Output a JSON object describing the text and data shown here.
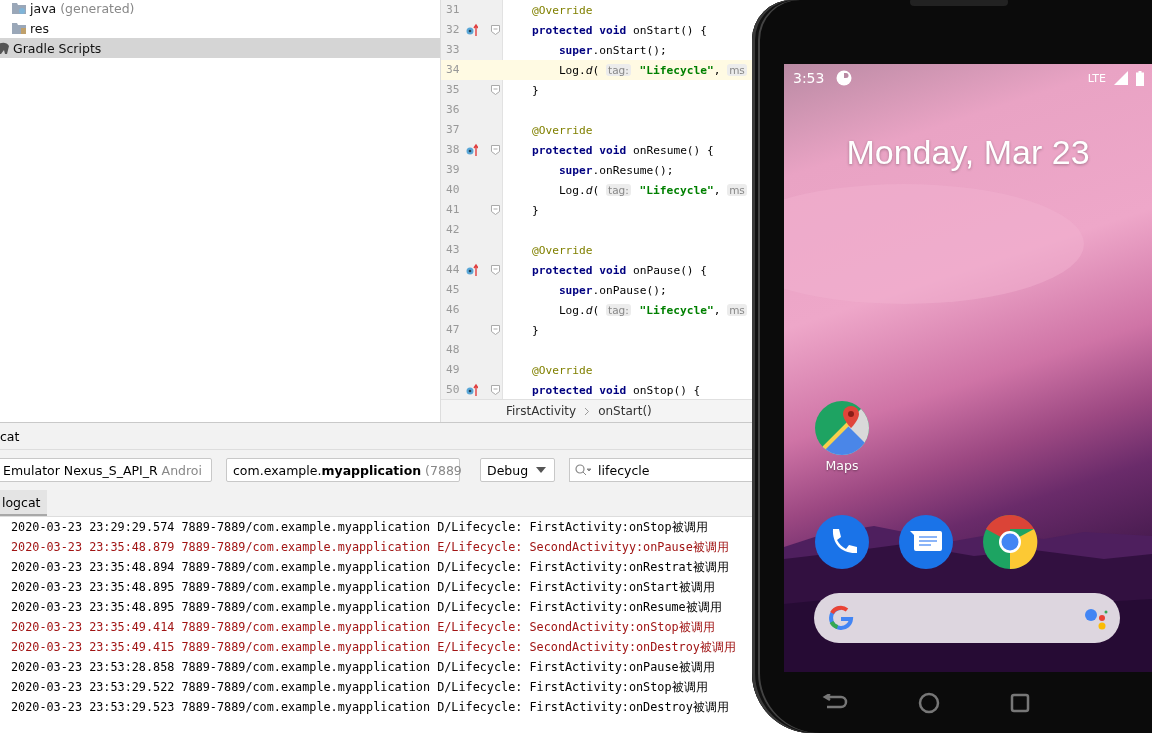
{
  "project_tree": {
    "items": [
      {
        "label": "java",
        "note": "(generated)",
        "kind": "java-folder",
        "selected": false
      },
      {
        "label": "res",
        "kind": "res-folder",
        "selected": false
      },
      {
        "label": "Gradle Scripts",
        "kind": "gradle",
        "selected": true
      }
    ]
  },
  "editor": {
    "lines": [
      {
        "number": "31",
        "override": false,
        "fold": false,
        "current": false,
        "segments": [
          {
            "t": "    @Override",
            "kind": "annotation"
          }
        ]
      },
      {
        "number": "32",
        "override": true,
        "fold": true,
        "current": false,
        "segments": [
          {
            "t": "    protected void",
            "kind": "keyword"
          },
          {
            "t": " onStart() {",
            "kind": "plain"
          }
        ]
      },
      {
        "number": "33",
        "override": false,
        "fold": false,
        "current": false,
        "segments": [
          {
            "t": "        super",
            "kind": "keyword"
          },
          {
            "t": ".onStart();",
            "kind": "plain"
          }
        ]
      },
      {
        "number": "34",
        "override": false,
        "fold": false,
        "current": true,
        "segments": [
          {
            "t": "        Log.",
            "kind": "plain"
          },
          {
            "t": "d",
            "kind": "italic"
          },
          {
            "t": "( ",
            "kind": "plain"
          },
          {
            "t": "tag:",
            "kind": "hint"
          },
          {
            "t": " \"Lifecycle\"",
            "kind": "string"
          },
          {
            "t": ", ",
            "kind": "plain"
          },
          {
            "t": "ms",
            "kind": "hint"
          }
        ]
      },
      {
        "number": "35",
        "override": false,
        "fold": true,
        "current": false,
        "segments": [
          {
            "t": "    }",
            "kind": "plain"
          }
        ]
      },
      {
        "number": "36",
        "override": false,
        "fold": false,
        "current": false
      },
      {
        "number": "37",
        "override": false,
        "fold": false,
        "current": false,
        "segments": [
          {
            "t": "    @Override",
            "kind": "annotation"
          }
        ]
      },
      {
        "number": "38",
        "override": true,
        "fold": true,
        "current": false,
        "segments": [
          {
            "t": "    protected void",
            "kind": "keyword"
          },
          {
            "t": " onResume() {",
            "kind": "plain"
          }
        ]
      },
      {
        "number": "39",
        "override": false,
        "fold": false,
        "current": false,
        "segments": [
          {
            "t": "        super",
            "kind": "keyword"
          },
          {
            "t": ".onResume();",
            "kind": "plain"
          }
        ]
      },
      {
        "number": "40",
        "override": false,
        "fold": false,
        "current": false,
        "segments": [
          {
            "t": "        Log.",
            "kind": "plain"
          },
          {
            "t": "d",
            "kind": "italic"
          },
          {
            "t": "( ",
            "kind": "plain"
          },
          {
            "t": "tag:",
            "kind": "hint"
          },
          {
            "t": " \"Lifecycle\"",
            "kind": "string"
          },
          {
            "t": ", ",
            "kind": "plain"
          },
          {
            "t": "ms",
            "kind": "hint"
          }
        ]
      },
      {
        "number": "41",
        "override": false,
        "fold": true,
        "current": false,
        "segments": [
          {
            "t": "    }",
            "kind": "plain"
          }
        ]
      },
      {
        "number": "42",
        "override": false,
        "fold": false,
        "current": false
      },
      {
        "number": "43",
        "override": false,
        "fold": false,
        "current": false,
        "segments": [
          {
            "t": "    @Override",
            "kind": "annotation"
          }
        ]
      },
      {
        "number": "44",
        "override": true,
        "fold": true,
        "current": false,
        "segments": [
          {
            "t": "    protected void",
            "kind": "keyword"
          },
          {
            "t": " onPause() {",
            "kind": "plain"
          }
        ]
      },
      {
        "number": "45",
        "override": false,
        "fold": false,
        "current": false,
        "segments": [
          {
            "t": "        super",
            "kind": "keyword"
          },
          {
            "t": ".onPause();",
            "kind": "plain"
          }
        ]
      },
      {
        "number": "46",
        "override": false,
        "fold": false,
        "current": false,
        "segments": [
          {
            "t": "        Log.",
            "kind": "plain"
          },
          {
            "t": "d",
            "kind": "italic"
          },
          {
            "t": "( ",
            "kind": "plain"
          },
          {
            "t": "tag:",
            "kind": "hint"
          },
          {
            "t": " \"Lifecycle\"",
            "kind": "string"
          },
          {
            "t": ", ",
            "kind": "plain"
          },
          {
            "t": "ms",
            "kind": "hint"
          }
        ]
      },
      {
        "number": "47",
        "override": false,
        "fold": true,
        "current": false,
        "segments": [
          {
            "t": "    }",
            "kind": "plain"
          }
        ]
      },
      {
        "number": "48",
        "override": false,
        "fold": false,
        "current": false
      },
      {
        "number": "49",
        "override": false,
        "fold": false,
        "current": false,
        "segments": [
          {
            "t": "    @Override",
            "kind": "annotation"
          }
        ]
      },
      {
        "number": "50",
        "override": true,
        "fold": true,
        "current": false,
        "segments": [
          {
            "t": "    protected void",
            "kind": "keyword"
          },
          {
            "t": " onStop() {",
            "kind": "plain"
          }
        ]
      }
    ],
    "breadcrumb": [
      "FirstActivity",
      "onStart()"
    ]
  },
  "logcat": {
    "title": "cat",
    "device": {
      "value": "Emulator Nexus_S_API_R",
      "note": "Androi"
    },
    "process": {
      "value": "com.example.**myapplication**",
      "note": "(7889"
    },
    "log_level": "Debug",
    "search": {
      "value": "lifecycle"
    },
    "tabs": [
      {
        "label": "logcat",
        "selected": true
      }
    ],
    "rows": [
      {
        "kind": "debug",
        "text": "2020-03-23 23:29:29.574 7889-7889/com.example.myapplication D/Lifecycle: FirstActivity:onStop被调用"
      },
      {
        "kind": "error",
        "text": "2020-03-23 23:35:48.879 7889-7889/com.example.myapplication E/Lifecycle: SecondActivityy:onPause被调用"
      },
      {
        "kind": "debug",
        "text": "2020-03-23 23:35:48.894 7889-7889/com.example.myapplication D/Lifecycle: FirstActivity:onRestrat被调用"
      },
      {
        "kind": "debug",
        "text": "2020-03-23 23:35:48.895 7889-7889/com.example.myapplication D/Lifecycle: FirstActivity:onStart被调用"
      },
      {
        "kind": "debug",
        "text": "2020-03-23 23:35:48.895 7889-7889/com.example.myapplication D/Lifecycle: FirstActivity:onResume被调用"
      },
      {
        "kind": "error",
        "text": "2020-03-23 23:35:49.414 7889-7889/com.example.myapplication E/Lifecycle: SecondActivity:onStop被调用"
      },
      {
        "kind": "error",
        "text": "2020-03-23 23:35:49.415 7889-7889/com.example.myapplication E/Lifecycle: SecondActivity:onDestroy被调用"
      },
      {
        "kind": "debug",
        "text": "2020-03-23 23:53:28.858 7889-7889/com.example.myapplication D/Lifecycle: FirstActivity:onPause被调用"
      },
      {
        "kind": "debug",
        "text": "2020-03-23 23:53:29.522 7889-7889/com.example.myapplication D/Lifecycle: FirstActivity:onStop被调用"
      },
      {
        "kind": "debug",
        "text": "2020-03-23 23:53:29.523 7889-7889/com.example.myapplication D/Lifecycle: FirstActivity:onDestroy被调用"
      }
    ]
  },
  "phone": {
    "status_bar": {
      "time": "3:53",
      "network": "LTE"
    },
    "date": "Monday, Mar 23",
    "apps": [
      {
        "label": "Maps",
        "kind": "maps"
      }
    ],
    "dock": [
      {
        "kind": "phone"
      },
      {
        "kind": "messages"
      },
      {
        "kind": "chrome"
      }
    ]
  }
}
